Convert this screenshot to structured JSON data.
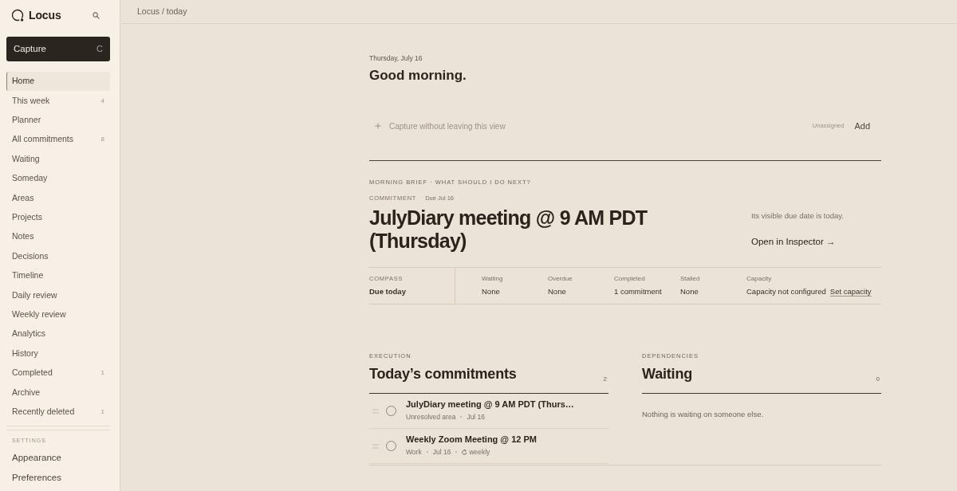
{
  "sidebar": {
    "logo": "Locus",
    "capture_button": {
      "label": "Capture",
      "shortcut": "C"
    },
    "nav_items": [
      {
        "label": "Home",
        "selected": true
      },
      {
        "label": "This week",
        "count": "4",
        "selected": false
      },
      {
        "label": "Planner",
        "selected": false
      },
      {
        "label": "All commitments",
        "count": "8",
        "selected": false
      },
      {
        "label": "Waiting",
        "selected": false
      },
      {
        "label": "Someday",
        "selected": false
      },
      {
        "label": "Areas",
        "selected": false
      },
      {
        "label": "Projects",
        "selected": false
      },
      {
        "label": "Notes",
        "selected": false
      },
      {
        "label": "Decisions",
        "selected": false
      },
      {
        "label": "Timeline",
        "selected": false
      },
      {
        "label": "Daily review",
        "selected": false
      },
      {
        "label": "Weekly review",
        "selected": false
      },
      {
        "label": "Analytics",
        "selected": false
      },
      {
        "label": "History",
        "selected": false
      },
      {
        "label": "Completed",
        "count": "1",
        "selected": false
      },
      {
        "label": "Archive",
        "selected": false
      },
      {
        "label": "Recently deleted",
        "count": "1",
        "selected": false
      }
    ],
    "settings": {
      "heading": "SETTINGS",
      "items": [
        {
          "label": "Appearance"
        },
        {
          "label": "Preferences"
        }
      ]
    }
  },
  "top_bar": {
    "breadcrumb": "Locus / today"
  },
  "header": {
    "date": "Thursday, July 16",
    "greeting": "Good morning."
  },
  "quick_capture": {
    "placeholder": "Capture without leaving this view",
    "assignee": "Unassigned",
    "add_button": "Add"
  },
  "morning_brief": {
    "heading": "MORNING BRIEF · WHAT SHOULD I DO NEXT?",
    "type_label": "COMMITMENT",
    "due": "Due Jul 16",
    "title": "JulyDiary meeting @ 9 AM PDT (Thursday)",
    "reason": "Its visible due date is today.",
    "link": "Open in Inspector →",
    "compass": {
      "label": "COMPASS",
      "value": "Due today"
    },
    "stats": [
      {
        "label": "Waiting",
        "value": "None"
      },
      {
        "label": "Overdue",
        "value": "None"
      },
      {
        "label": "Completed",
        "value": "1 commitment"
      },
      {
        "label": "Stalled",
        "value": "None"
      },
      {
        "label": "Capacity",
        "value": "Capacity not configured",
        "action": "Set capacity"
      }
    ]
  },
  "execution": {
    "kicker": "EXECUTION",
    "title": "Today’s commitments",
    "count": "2",
    "items": [
      {
        "title": "JulyDiary meeting @ 9 AM PDT (Thurs…",
        "checked": false,
        "meta": [
          {
            "kind": "area",
            "text": "Unresolved area"
          },
          {
            "kind": "date",
            "text": "Jul 16"
          }
        ]
      },
      {
        "title": "Weekly Zoom Meeting @ 12 PM",
        "checked": false,
        "meta": [
          {
            "kind": "area",
            "text": "Work"
          },
          {
            "kind": "date",
            "text": "Jul 16"
          },
          {
            "kind": "repeat",
            "text": "weekly"
          }
        ]
      }
    ]
  },
  "dependencies": {
    "kicker": "DEPENDENCIES",
    "title": "Waiting",
    "count": "0",
    "empty_message": "Nothing is waiting on someone else."
  }
}
